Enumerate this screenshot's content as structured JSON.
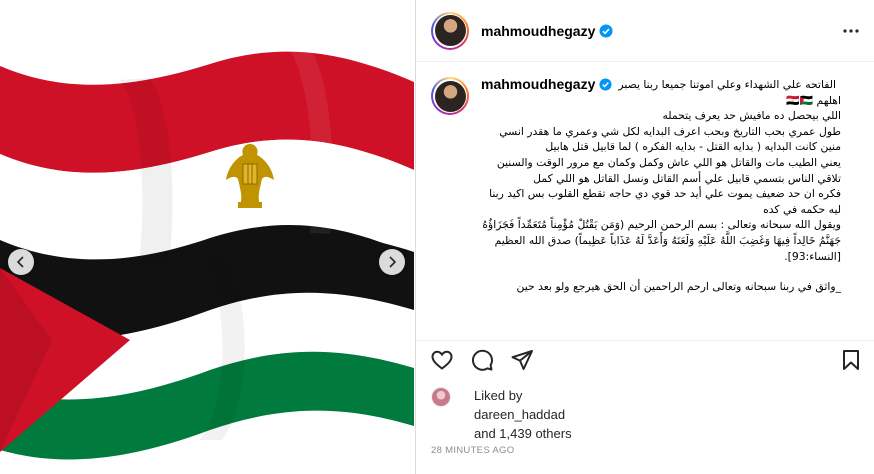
{
  "post": {
    "username": "mahmoudhegazy",
    "caption_first_line": "الفاتحه علي الشهداء وعلي اموتنا جميعا ربنا يصبر",
    "caption_lines": [
      "اهلهم 🇪🇬🇵🇸",
      "اللي بيحصل ده مافيش حد يعرف يتحمله",
      "طول عمري بحب التاريخ وبحب اعرف البدايه لكل شي وعمري ما هقدر انسي",
      "منين كانت البدايه ( بدايه القتل - بدايه الفكره ) لما قابيل قتل هابيل",
      "يعني الطيب مات والقاتل هو اللي عاش وكمل وكمان مع مرور الوقت والسنين",
      "تلاقي الناس بتسمي قابيل علي أسم القاتل ونسل القاتل هو اللي كمل",
      "فكره ان حد ضعيف يموت علي أيد حد قوي دي حاجه تقطع القلوب بس اكيد ربنا",
      "ليه حكمه في كده",
      "ويقول الله سبحانه وتعالى : بسم الرحمن الرحيم (وَمَن يَقْتُلْ مُؤْمِناً مُتَعَمِّداً فَجَزَاؤُهُ",
      "جَهَنَّمُ خَالِداً فِيهَا وَغَضِبَ اللَّهُ عَلَيْهِ وَلَعَنَهُ وَأَعَدَّ لَهُ عَذَاباً عَظِيماً) صدق الله العظيم",
      "[النساء:93]."
    ],
    "caption_last_line": "_واثق في ربنا سبحانه وتعالى ارحم الراحمين أن الحق هيرجع ولو بعد حين",
    "liked_by_label": "Liked by",
    "liked_by_user": "dareen_haddad",
    "likes_others": "and 1,439 others",
    "timestamp": "28 MINUTES AGO"
  },
  "colors": {
    "verified_blue": "#0095f6",
    "egypt_red": "#ce1126",
    "egypt_eagle_gold": "#c09300",
    "palestine_green": "#007a3d",
    "palestine_red": "#ce1126"
  },
  "icons": {
    "more": "more-options-icon",
    "like": "heart-icon",
    "comment": "comment-icon",
    "share": "paper-plane-icon",
    "save": "bookmark-icon",
    "verified": "verified-badge-icon",
    "prev": "chevron-left-icon",
    "next": "chevron-right-icon"
  }
}
